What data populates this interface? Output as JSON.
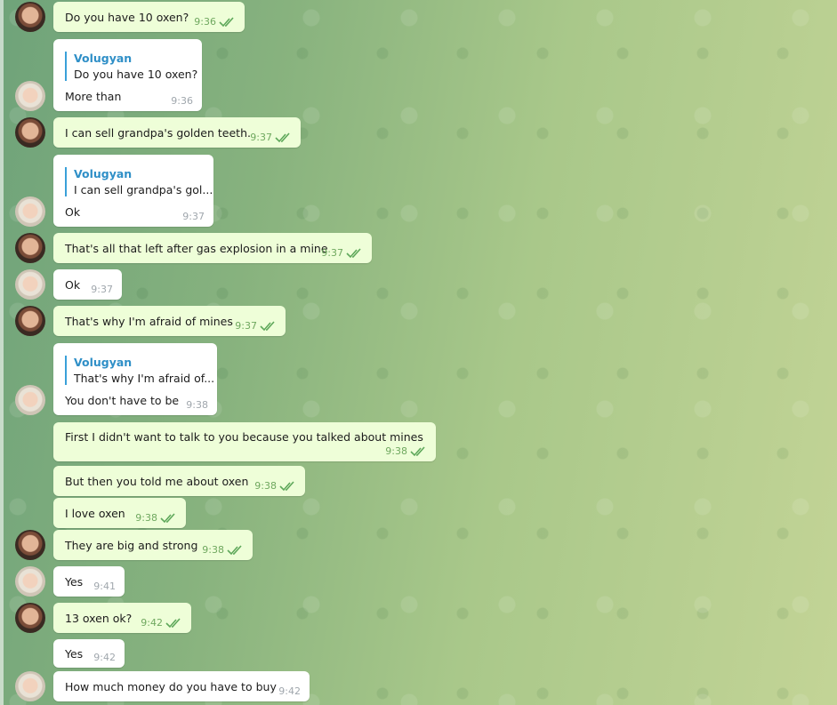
{
  "chat": {
    "messages": [
      {
        "text": "Do you have 10 oxen?",
        "time": "9:36"
      },
      {
        "reply_name": "Volugyan",
        "reply_text": "Do you have 10 oxen?",
        "text": "More than",
        "time": "9:36"
      },
      {
        "text": "I can sell grandpa's golden teeth.",
        "time": "9:37"
      },
      {
        "reply_name": "Volugyan",
        "reply_text": "I can sell grandpa's gol...",
        "text": "Ok",
        "time": "9:37"
      },
      {
        "text": "That's all that left after gas explosion in a mine",
        "time": "9:37"
      },
      {
        "text": "Ok",
        "time": "9:37"
      },
      {
        "text": "That's why I'm afraid of mines",
        "time": "9:37"
      },
      {
        "reply_name": "Volugyan",
        "reply_text": "That's why I'm afraid of...",
        "text": "You don't have to be",
        "time": "9:38"
      },
      {
        "text": "First I didn't want to talk to you because you talked about mines",
        "time": "9:38"
      },
      {
        "text": "But then you told me about oxen",
        "time": "9:38"
      },
      {
        "text": "I love oxen",
        "time": "9:38"
      },
      {
        "text": "They are big and strong",
        "time": "9:38"
      },
      {
        "text": "Yes",
        "time": "9:41"
      },
      {
        "text": "13 oxen ok?",
        "time": "9:42"
      },
      {
        "text": "Yes",
        "time": "9:42"
      },
      {
        "text": "How much money do you have to buy",
        "time": "9:42"
      }
    ]
  },
  "colors": {
    "outgoing": "#eefed8",
    "incoming": "#ffffff",
    "check": "#6fa85f",
    "reply_accent": "#2f8fc7"
  },
  "icons": {
    "read": "double-check-icon",
    "avatar_out": "avatar-man",
    "avatar_in": "avatar-woman"
  }
}
